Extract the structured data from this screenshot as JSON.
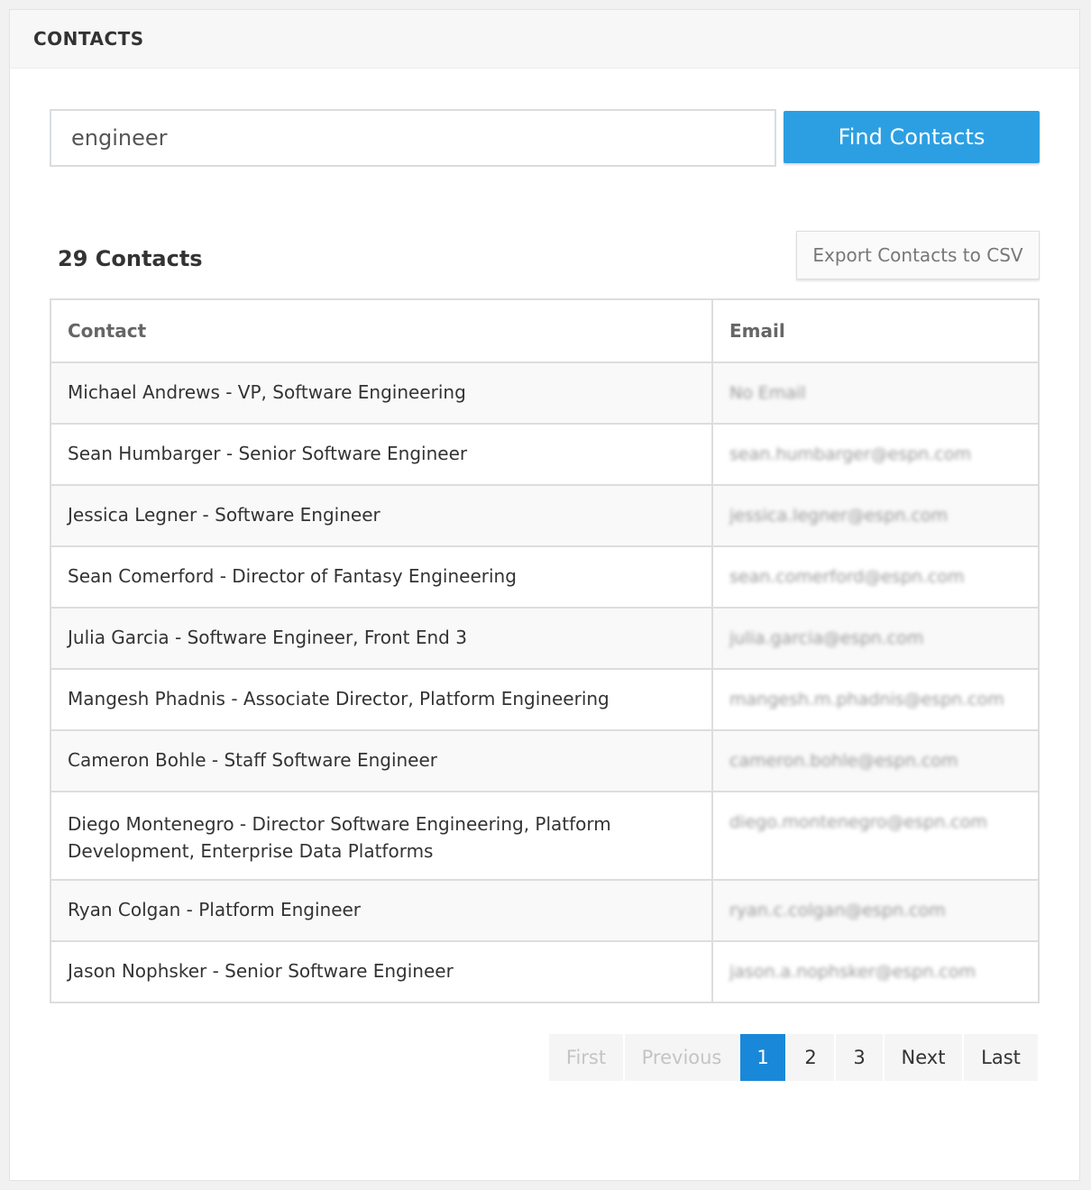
{
  "panel": {
    "title": "CONTACTS"
  },
  "search": {
    "value": "engineer",
    "button_label": "Find Contacts"
  },
  "results": {
    "count_label": "29 Contacts",
    "export_label": "Export Contacts to CSV"
  },
  "table": {
    "headers": [
      "Contact",
      "Email"
    ],
    "rows": [
      {
        "contact": "Michael Andrews - VP, Software Engineering",
        "email": "No Email"
      },
      {
        "contact": "Sean Humbarger - Senior Software Engineer",
        "email": "sean.humbarger@espn.com"
      },
      {
        "contact": "Jessica Legner - Software Engineer",
        "email": "jessica.legner@espn.com"
      },
      {
        "contact": "Sean Comerford - Director of Fantasy Engineering",
        "email": "sean.comerford@espn.com"
      },
      {
        "contact": "Julia Garcia - Software Engineer, Front End 3",
        "email": "julia.garcia@espn.com"
      },
      {
        "contact": "Mangesh Phadnis - Associate Director, Platform Engineering",
        "email": "mangesh.m.phadnis@espn.com"
      },
      {
        "contact": "Cameron Bohle - Staff Software Engineer",
        "email": "cameron.bohle@espn.com"
      },
      {
        "contact": "Diego Montenegro - Director Software Engineering, Platform Development, Enterprise Data Platforms",
        "email": "diego.montenegro@espn.com"
      },
      {
        "contact": "Ryan Colgan - Platform Engineer",
        "email": "ryan.c.colgan@espn.com"
      },
      {
        "contact": "Jason Nophsker - Senior Software Engineer",
        "email": "jason.a.nophsker@espn.com"
      }
    ]
  },
  "pagination": {
    "first": "First",
    "previous": "Previous",
    "pages": [
      "1",
      "2",
      "3"
    ],
    "current": "1",
    "next": "Next",
    "last": "Last"
  }
}
